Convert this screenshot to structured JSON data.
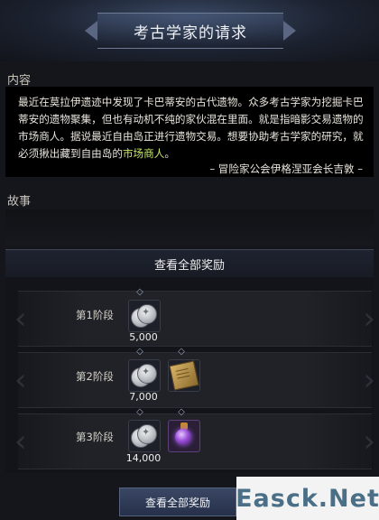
{
  "title": "考古学家的请求",
  "content": {
    "label": "内容",
    "text_before": "最近在莫拉伊遗迹中发现了卡巴蒂安的古代遗物。众多考古学家为挖掘卡巴蒂安的遗物聚集，但也有动机不纯的家伙混在里面。就是指暗影交易遗物的市场商人。据说最近自由岛正进行遗物交易。想要协助考古学家的研究，就必须揪出藏到自由岛的",
    "highlight": "市场商人",
    "text_after": "。",
    "signature": "– 冒险家公会伊格涅亚会长吉敦 –"
  },
  "story": {
    "label": "故事"
  },
  "rewards": {
    "header": "查看全部奖励",
    "stages": [
      {
        "label": "第1阶段",
        "amount": "5,000",
        "items": [
          "silver-coins"
        ]
      },
      {
        "label": "第2阶段",
        "amount": "7,000",
        "items": [
          "silver-coins",
          "treasure-map"
        ]
      },
      {
        "label": "第3阶段",
        "amount": "14,000",
        "items": [
          "silver-coins",
          "purple-orb-lantern"
        ]
      }
    ]
  },
  "bottom_button": "查看全部奖励",
  "watermark": "Easck.Net",
  "colors": {
    "highlight": "#c6e86a",
    "background": "#14161c",
    "title_bar": "#3a4a66"
  }
}
